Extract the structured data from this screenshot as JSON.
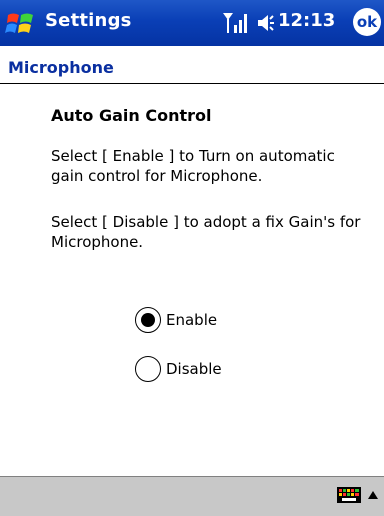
{
  "title_bar": {
    "title": "Settings",
    "time": "12:13",
    "ok_label": "ok",
    "icons": [
      "windows-start-icon",
      "signal-icon",
      "speaker-icon"
    ],
    "bg_color": "#0a3fb6"
  },
  "header": {
    "title": "Microphone",
    "color": "#0a2fa0"
  },
  "content": {
    "section_title": "Auto Gain Control",
    "para1": "Select [ Enable ] to Turn on automatic gain control for Microphone.",
    "para2": "Select [ Disable ] to adopt a fix Gain's for Microphone.",
    "options": [
      {
        "label": "Enable",
        "selected": true
      },
      {
        "label": "Disable",
        "selected": false
      }
    ]
  },
  "bottom_bar": {
    "icons": [
      "keyboard-icon",
      "sip-arrow-icon"
    ]
  }
}
